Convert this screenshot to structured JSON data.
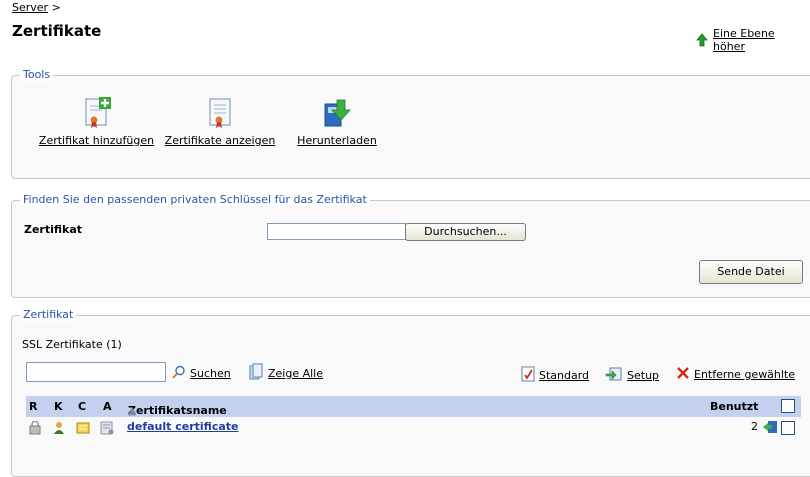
{
  "header": {
    "breadcrumb": "Server",
    "breadcrumb_sep": ">",
    "title": "Zertifikate",
    "up_link": "Eine Ebene höher"
  },
  "tools": {
    "legend": "Tools",
    "items": [
      {
        "label": "Zertifikat hinzufügen",
        "icon": "certificate-add-icon"
      },
      {
        "label": "Zertifikate anzeigen",
        "icon": "certificate-view-icon"
      },
      {
        "label": "Herunterladen",
        "icon": "download-icon"
      }
    ]
  },
  "finder": {
    "legend": "Finden Sie den passenden privaten Schlüssel für das Zertifikat",
    "field_label": "Zertifikat",
    "file_value": "",
    "browse_label": "Durchsuchen...",
    "send_label": "Sende Datei"
  },
  "certs": {
    "legend": "Zertifikat",
    "list_title": "SSL Zertifikate (1)",
    "search_value": "",
    "search_label": "Suchen",
    "show_all_label": "Zeige Alle",
    "standard_label": "Standard",
    "setup_label": "Setup",
    "remove_label": "Entferne gewählte",
    "columns": {
      "r": "R",
      "k": "K",
      "c": "C",
      "a": "A",
      "name": "Zertifikatsname",
      "used": "Benutzt"
    },
    "sort_indicator": "▲",
    "rows": [
      {
        "name": "default certificate",
        "used": "2"
      }
    ]
  },
  "colors": {
    "accent": "#2a52a8",
    "grid_header": "#c3d1ef",
    "link": "#1f3f9e",
    "remove_x": "#d42a16",
    "up_arrow": "#2a9a2a"
  }
}
